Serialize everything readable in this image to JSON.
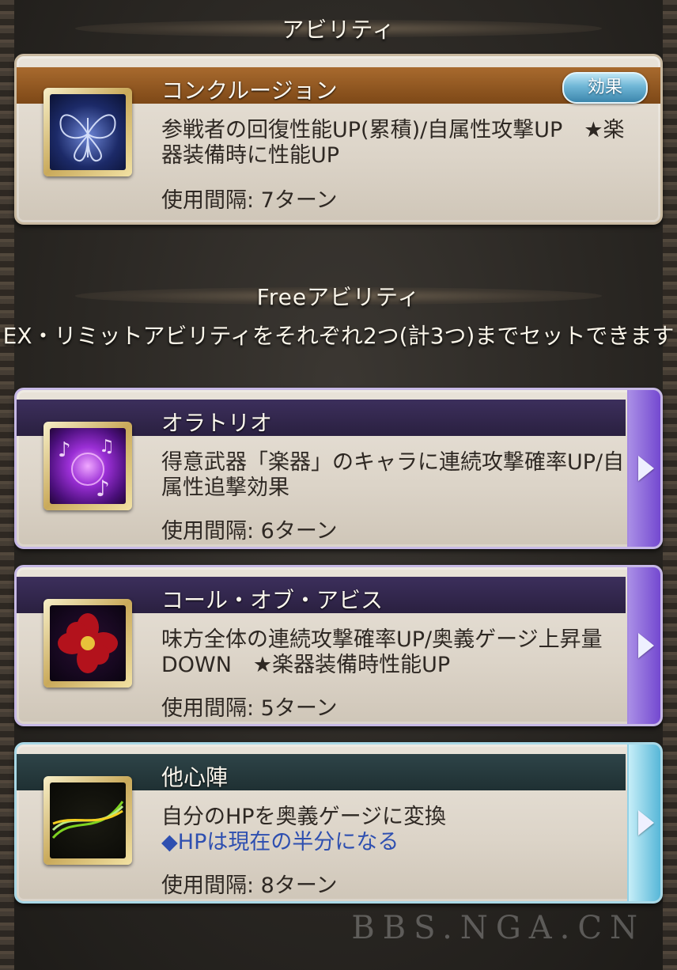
{
  "ability_section": {
    "header": "アビリティ",
    "card": {
      "name": "コンクルージョン",
      "effect_button": "効果",
      "description": "参戦者の回復性能UP(累積)/自属性攻撃UP　★楽器装備時に性能UP",
      "interval": "使用間隔: 7ターン",
      "icon": "butterfly-icon"
    }
  },
  "free_section": {
    "header": "Freeアビリティ",
    "description": "EX・リミットアビリティをそれぞれ2つ(計3つ)までセットできます",
    "cards": [
      {
        "name": "オラトリオ",
        "description": "得意武器「楽器」のキャラに連続攻撃確率UP/自属性追撃効果",
        "note": "",
        "interval": "使用間隔: 6ターン",
        "icon": "music-notes-icon"
      },
      {
        "name": "コール・オブ・アビス",
        "description": "味方全体の連続攻撃確率UP/奥義ゲージ上昇量DOWN　★楽器装備時性能UP",
        "note": "",
        "interval": "使用間隔: 5ターン",
        "icon": "red-flower-icon"
      },
      {
        "name": "他心陣",
        "description": "自分のHPを奥義ゲージに変換",
        "note": "◆HPは現在の半分になる",
        "interval": "使用間隔: 8ターン",
        "icon": "green-swirl-icon"
      }
    ]
  },
  "watermark": "BBS.NGA.CN",
  "colors": {
    "main_title_bar": "#9a5f26",
    "purple_title_bar": "#33284d",
    "teal_title_bar": "#263a3d",
    "effect_button": "#5aa9cc",
    "note_text": "#2e4fb0"
  }
}
